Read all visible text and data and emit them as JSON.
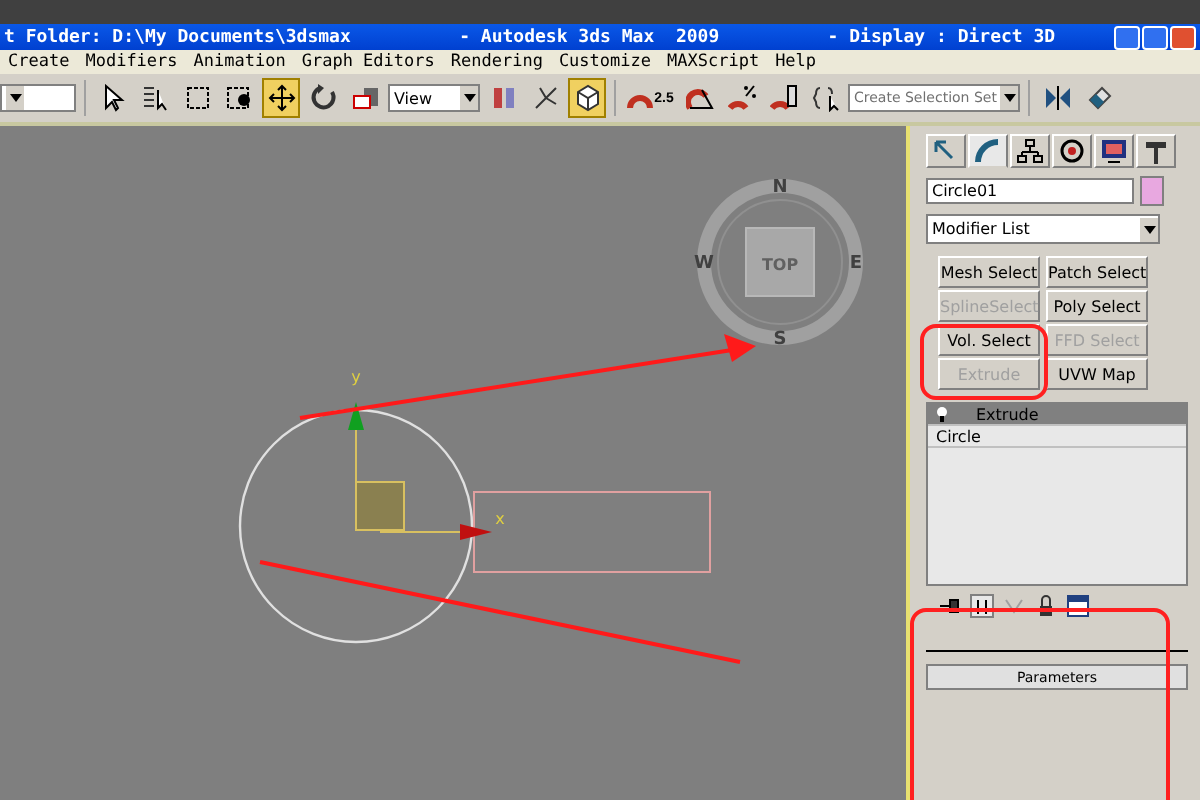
{
  "window": {
    "title": "t Folder: D:\\My Documents\\3dsmax          - Autodesk 3ds Max  2009          - Display : Direct 3D"
  },
  "menu": [
    "Create",
    "Modifiers",
    "Animation",
    "Graph Editors",
    "Rendering",
    "Customize",
    "MAXScript",
    "Help"
  ],
  "toolbar": {
    "tools_left": [
      {
        "kind": "select",
        "selected": false
      },
      {
        "kind": "select-by-name",
        "selected": false
      },
      {
        "kind": "region",
        "selected": false
      },
      {
        "kind": "window",
        "selected": false
      },
      {
        "kind": "move",
        "selected": true
      },
      {
        "kind": "rotate",
        "selected": false
      },
      {
        "kind": "scale",
        "selected": false
      }
    ],
    "reference_coord": "View",
    "tools_mid": [
      {
        "kind": "pivot",
        "selected": false
      },
      {
        "kind": "manipulate",
        "selected": false
      },
      {
        "kind": "keyboard",
        "selected": true
      },
      {
        "kind": "snap",
        "selected": false
      },
      {
        "kind": "angle-snap",
        "selected": false
      },
      {
        "kind": "percent-snap",
        "selected": false
      },
      {
        "kind": "spinner-snap",
        "selected": false
      },
      {
        "kind": "named-sets",
        "selected": false
      }
    ],
    "snap_label": "2.5",
    "selection_set_placeholder": "Create Selection Set",
    "tools_right": [
      {
        "kind": "mirror",
        "selected": false
      },
      {
        "kind": "align",
        "selected": false
      }
    ]
  },
  "viewport": {
    "compass": {
      "top": "TOP",
      "north": "N",
      "west": "W",
      "east": "E",
      "south": "S"
    },
    "axis": {
      "x": "x",
      "y": "y"
    }
  },
  "command_panel": {
    "tabs": [
      {
        "kind": "create",
        "selected": false
      },
      {
        "kind": "modify",
        "selected": true
      },
      {
        "kind": "hierarchy",
        "selected": false
      },
      {
        "kind": "motion",
        "selected": false
      },
      {
        "kind": "display",
        "selected": false
      },
      {
        "kind": "utilities",
        "selected": false
      }
    ],
    "object_name": "Circle01",
    "modifier_list": "Modifier List",
    "modifier_buttons": [
      {
        "label": "Mesh Select",
        "disabled": false
      },
      {
        "label": "Patch Select",
        "disabled": false
      },
      {
        "label": "SplineSelect",
        "disabled": true
      },
      {
        "label": "Poly Select",
        "disabled": false
      },
      {
        "label": "Vol. Select",
        "disabled": false
      },
      {
        "label": "FFD Select",
        "disabled": true
      },
      {
        "label": "Extrude",
        "disabled": true
      },
      {
        "label": "UVW Map",
        "disabled": false
      }
    ],
    "stack": [
      {
        "label": "Extrude",
        "selected": true
      },
      {
        "label": "Circle",
        "selected": false
      }
    ],
    "rollout": "Parameters"
  }
}
